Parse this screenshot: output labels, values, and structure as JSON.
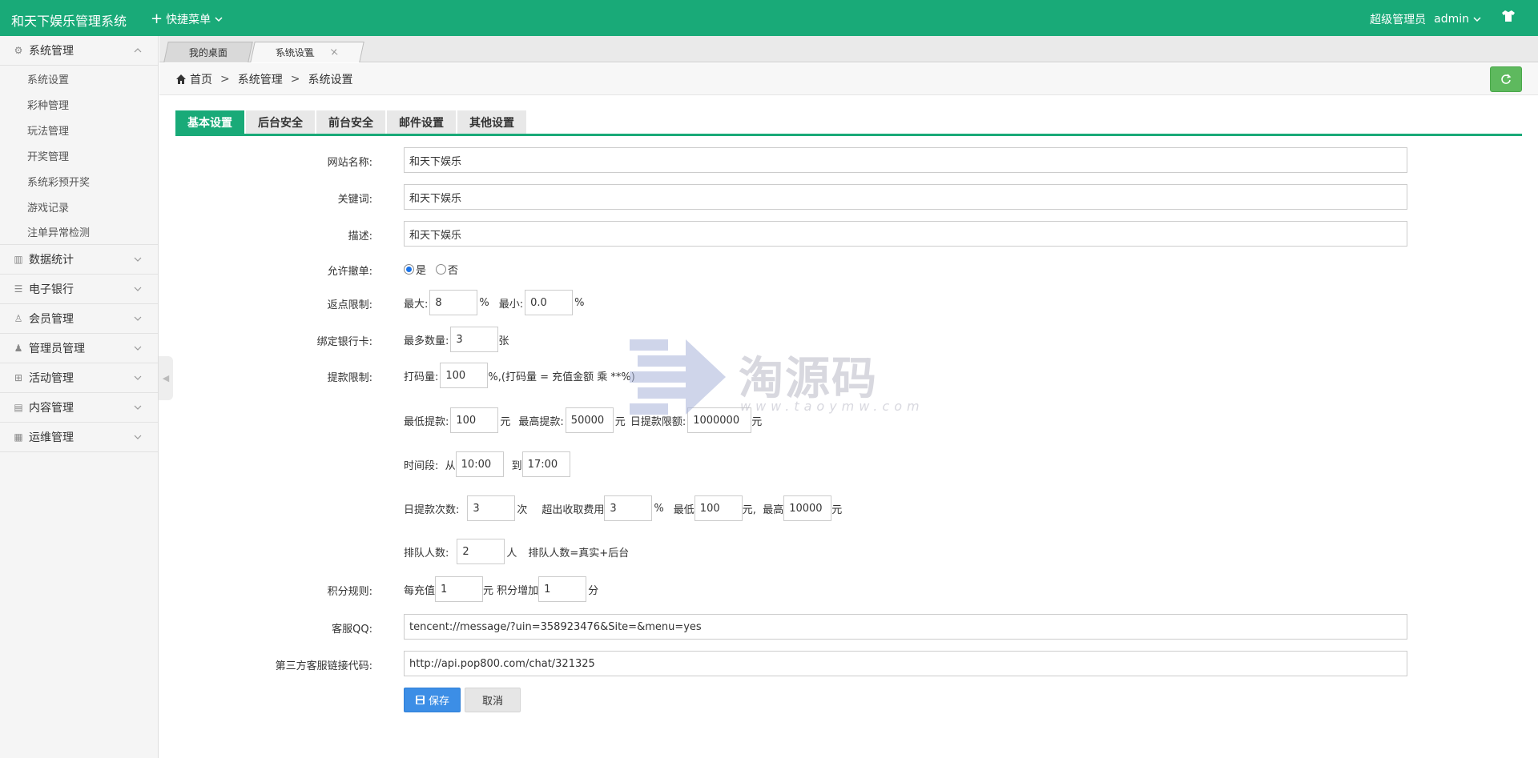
{
  "header": {
    "brand": "和天下娱乐管理系统",
    "quick_menu": "快捷菜单",
    "role": "超级管理员",
    "username": "admin"
  },
  "sidebar": {
    "groups": [
      {
        "label": "系统管理",
        "icon": "gear-icon",
        "expanded": true,
        "items": [
          "系统设置",
          "彩种管理",
          "玩法管理",
          "开奖管理",
          "系统彩预开奖",
          "游戏记录",
          "注单异常检测"
        ]
      },
      {
        "label": "数据统计",
        "icon": "chart-icon"
      },
      {
        "label": "电子银行",
        "icon": "list-icon"
      },
      {
        "label": "会员管理",
        "icon": "user-outline-icon"
      },
      {
        "label": "管理员管理",
        "icon": "user-icon"
      },
      {
        "label": "活动管理",
        "icon": "gift-icon"
      },
      {
        "label": "内容管理",
        "icon": "content-icon"
      },
      {
        "label": "运维管理",
        "icon": "ops-icon"
      }
    ]
  },
  "page_tabs": [
    {
      "label": "我的桌面"
    },
    {
      "label": "系统设置",
      "active": true,
      "close": "×"
    }
  ],
  "breadcrumb": {
    "home": "首页",
    "sep": ">",
    "level1": "系统管理",
    "level2": "系统设置"
  },
  "settings_tabs": [
    "基本设置",
    "后台安全",
    "前台安全",
    "邮件设置",
    "其他设置"
  ],
  "form": {
    "site_name": {
      "label": "网站名称:",
      "value": "和天下娱乐"
    },
    "keywords": {
      "label": "关键词:",
      "value": "和天下娱乐"
    },
    "description": {
      "label": "描述:",
      "value": "和天下娱乐"
    },
    "allow_cancel": {
      "label": "允许撤单:",
      "yes": "是",
      "no": "否",
      "selected": "是"
    },
    "rebate": {
      "label": "返点限制:",
      "max_label": "最大:",
      "max": "8",
      "unit1": "%",
      "min_label": "最小:",
      "min": "0.0",
      "unit2": "%"
    },
    "bind_card": {
      "label": "绑定银行卡:",
      "max_label": "最多数量:",
      "value": "3",
      "unit": "张"
    },
    "withdraw": {
      "label": "提款限制:",
      "bet_label": "打码量:",
      "bet": "100",
      "bet_note": "%,(打码量 = 充值金额 乘 **%)",
      "min_label": "最低提款:",
      "min": "100",
      "yuan": "元",
      "max_label": "最高提款:",
      "max": "50000",
      "daily_label": "日提款限额:",
      "daily": "1000000",
      "time_label": "时间段:  从",
      "from": "10:00",
      "to_label": "到",
      "to": "17:00",
      "count_label": "日提款次数:",
      "count": "3",
      "count_unit": "次",
      "fee_label": "超出收取费用",
      "fee": "3",
      "pct": "%",
      "fee_min_label": "最低",
      "fee_min": "100",
      "fee_max_label": "元,  最高",
      "fee_max": "10000",
      "queue_label": "排队人数:",
      "queue": "2",
      "queue_unit": "人",
      "queue_note": "排队人数=真实+后台"
    },
    "points": {
      "label": "积分规则:",
      "per_label": "每充值",
      "per": "1",
      "mid": "元 积分增加",
      "add": "1",
      "unit": "分"
    },
    "qq": {
      "label": "客服QQ:",
      "value": "tencent://message/?uin=358923476&Site=&menu=yes"
    },
    "third_party": {
      "label": "第三方客服链接代码:",
      "value": "http://api.pop800.com/chat/321325"
    },
    "save": "保存",
    "cancel": "取消"
  },
  "watermark": {
    "big": "淘源码",
    "small": "www.taoymw.com"
  },
  "colors": {
    "primary": "#19aa78",
    "save": "#3c8ee6",
    "refresh": "#5eb95e"
  }
}
